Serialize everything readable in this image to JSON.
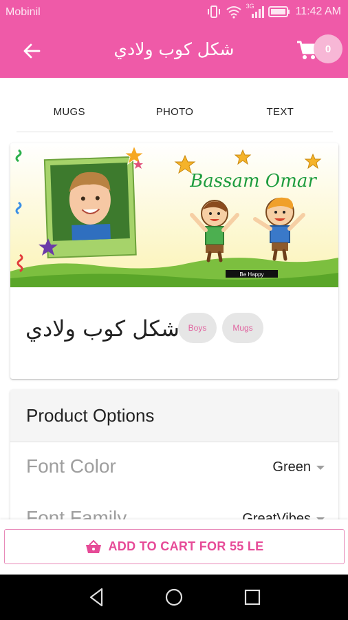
{
  "status_bar": {
    "carrier": "Mobinil",
    "network": "3G",
    "time": "11:42 AM"
  },
  "app_bar": {
    "title": "شكل كوب ولادي",
    "back_icon": "arrow-left-icon",
    "cart_icon": "shopping-cart-icon",
    "cart_count": "0"
  },
  "tabs": [
    {
      "label": "MUGS"
    },
    {
      "label": "PHOTO"
    },
    {
      "label": "TEXT"
    }
  ],
  "product": {
    "image_text": {
      "name": "Bassam Omar",
      "banner": "Be Happy"
    },
    "name": "شكل كوب ولادي",
    "tags": [
      "Boys",
      "Mugs"
    ]
  },
  "options": {
    "title": "Product Options",
    "rows": [
      {
        "label": "Font Color",
        "value": "Green"
      },
      {
        "label": "Font Family",
        "value": "GreatVibes"
      }
    ]
  },
  "add_to_cart": {
    "label": "ADD TO CART FOR 55 LE",
    "icon": "basket-icon"
  },
  "nav": {
    "back_icon": "nav-back-icon",
    "home_icon": "nav-home-icon",
    "recents_icon": "nav-recents-icon"
  },
  "colors": {
    "primary": "#ef5aa8",
    "accent": "#e64a97",
    "badge": "#f7b7d6"
  }
}
